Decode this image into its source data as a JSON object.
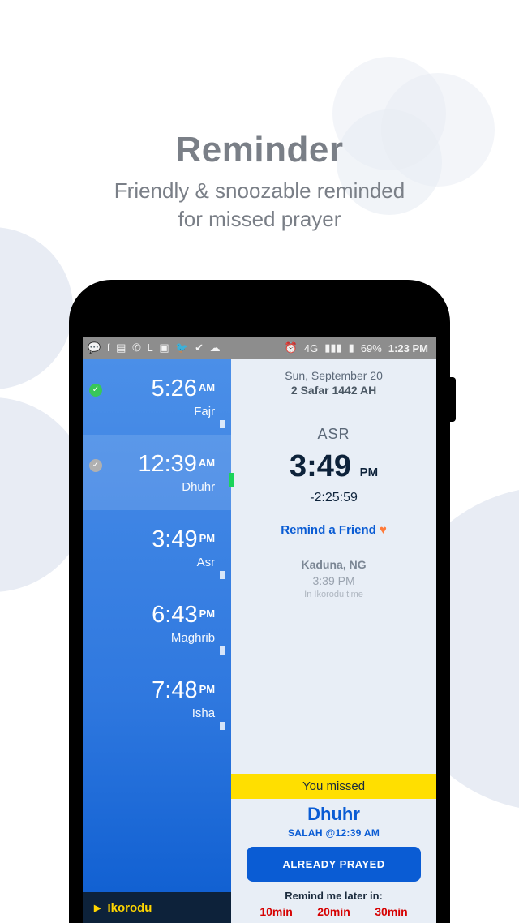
{
  "hero": {
    "title": "Reminder",
    "subtitle": "Friendly & snoozable reminded\nfor missed prayer"
  },
  "statusbar": {
    "battery": "69%",
    "net": "4G",
    "time": "1:23 PM"
  },
  "sidebar": {
    "prayers": [
      {
        "time": "5:26",
        "ampm": "AM",
        "name": "Fajr",
        "dot": "green"
      },
      {
        "time": "12:39",
        "ampm": "AM",
        "name": "Dhuhr",
        "dot": "grey",
        "active": true
      },
      {
        "time": "3:49",
        "ampm": "PM",
        "name": "Asr"
      },
      {
        "time": "6:43",
        "ampm": "PM",
        "name": "Maghrib"
      },
      {
        "time": "7:48",
        "ampm": "PM",
        "name": "Isha"
      }
    ],
    "location_label": "Ikorodu"
  },
  "main": {
    "date": "Sun, September 20",
    "hijri": "2 Safar 1442 AH",
    "current_prayer": "ASR",
    "current_time": "3:49",
    "current_ampm": "PM",
    "countdown": "-2:25:59",
    "remind_friend": "Remind a Friend",
    "location": "Kaduna, NG",
    "alt_time": "3:39 PM",
    "alt_note": "In Ikorodu time"
  },
  "missed": {
    "header": "You missed",
    "name": "Dhuhr",
    "detail": "SALAH @12:39 AM",
    "button": "ALREADY PRAYED",
    "later_label": "Remind me later in:",
    "options": [
      "10min",
      "20min",
      "30min"
    ]
  }
}
